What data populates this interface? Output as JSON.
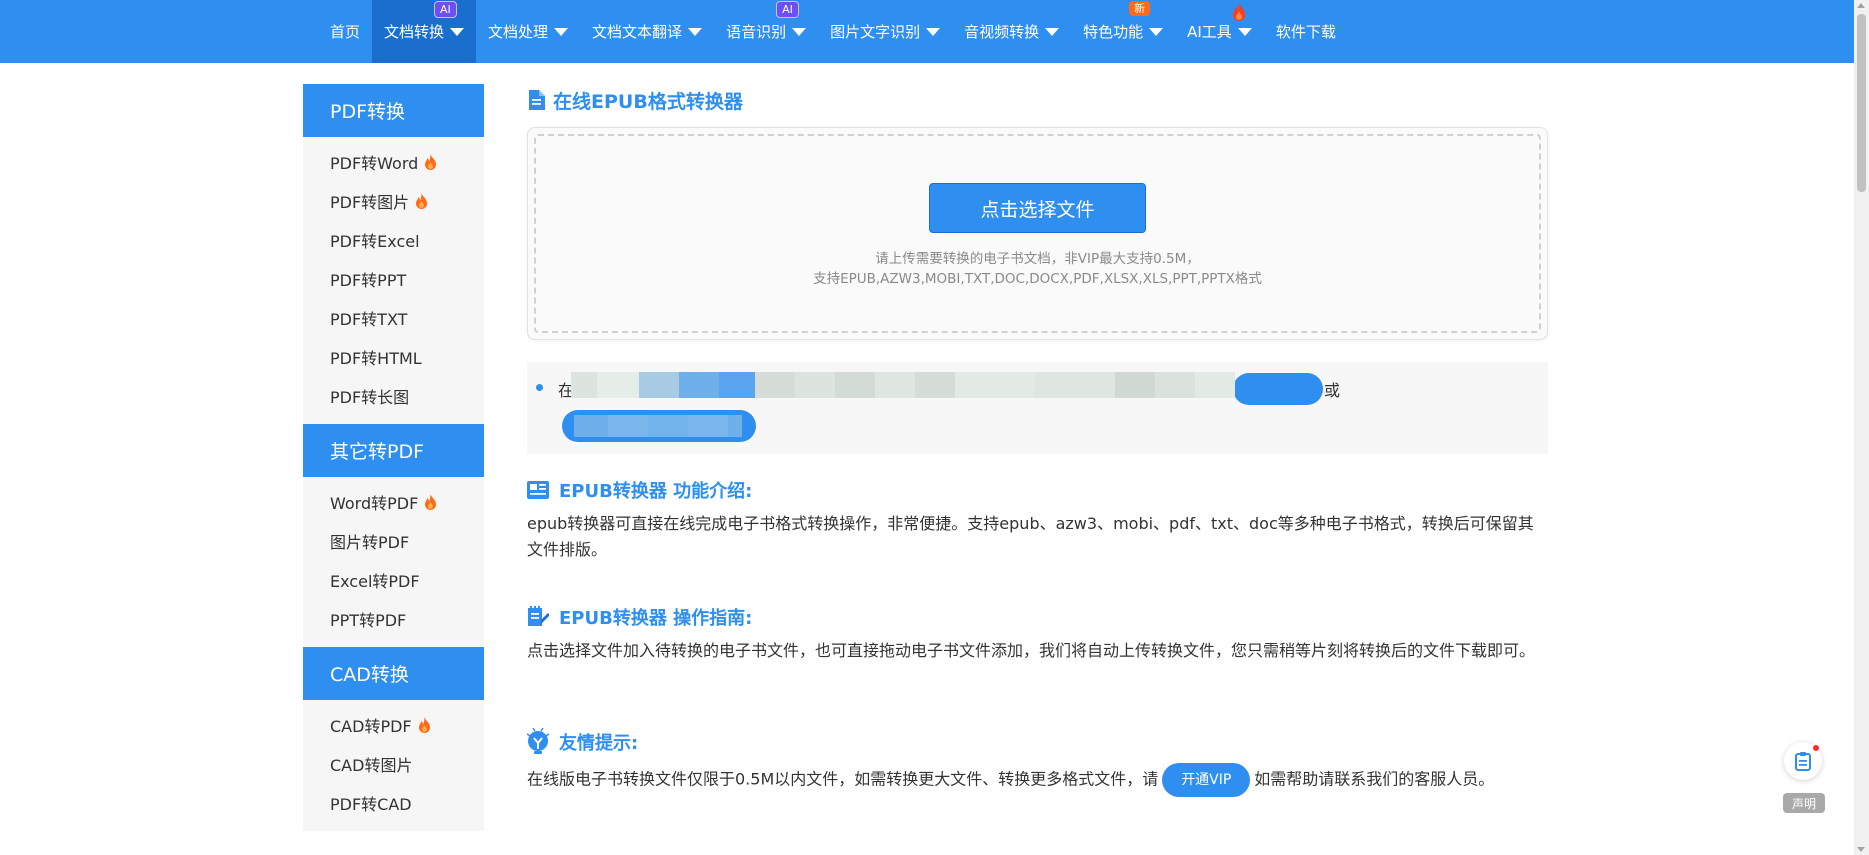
{
  "nav": {
    "items": [
      {
        "label": "首页",
        "caret": false,
        "badge": ""
      },
      {
        "label": "文档转换",
        "caret": true,
        "badge": "AI"
      },
      {
        "label": "文档处理",
        "caret": true,
        "badge": ""
      },
      {
        "label": "文档文本翻译",
        "caret": true,
        "badge": ""
      },
      {
        "label": "语音识别",
        "caret": true,
        "badge": "AI"
      },
      {
        "label": "图片文字识别",
        "caret": true,
        "badge": ""
      },
      {
        "label": "音视频转换",
        "caret": true,
        "badge": ""
      },
      {
        "label": "特色功能",
        "caret": true,
        "badge": "新"
      },
      {
        "label": "AI工具",
        "caret": true,
        "badge": "flame"
      },
      {
        "label": "软件下载",
        "caret": false,
        "badge": ""
      }
    ],
    "active_index": 1
  },
  "sidebar": {
    "groups": [
      {
        "title": "PDF转换",
        "items": [
          {
            "label": "PDF转Word",
            "hot": true
          },
          {
            "label": "PDF转图片",
            "hot": true
          },
          {
            "label": "PDF转Excel",
            "hot": false
          },
          {
            "label": "PDF转PPT",
            "hot": false
          },
          {
            "label": "PDF转TXT",
            "hot": false
          },
          {
            "label": "PDF转HTML",
            "hot": false
          },
          {
            "label": "PDF转长图",
            "hot": false
          }
        ]
      },
      {
        "title": "其它转PDF",
        "items": [
          {
            "label": "Word转PDF",
            "hot": true
          },
          {
            "label": "图片转PDF",
            "hot": false
          },
          {
            "label": "Excel转PDF",
            "hot": false
          },
          {
            "label": "PPT转PDF",
            "hot": false
          }
        ]
      },
      {
        "title": "CAD转换",
        "items": [
          {
            "label": "CAD转PDF",
            "hot": true
          },
          {
            "label": "CAD转图片",
            "hot": false
          },
          {
            "label": "PDF转CAD",
            "hot": false
          }
        ]
      }
    ]
  },
  "main": {
    "title": "在线EPUB格式转换器",
    "upload": {
      "button": "点击选择文件",
      "hint_line1": "请上传需要转换的电子书文档，非VIP最大支持0.5M，",
      "hint_line2": "支持EPUB,AZW3,MOBI,TXT,DOC,DOCX,PDF,XLSX,XLS,PPT,PPTX格式"
    },
    "notice": {
      "prefix": "在",
      "or": "或"
    },
    "sections": {
      "intro": {
        "title": "EPUB转换器 功能介绍:",
        "body": "epub转换器可直接在线完成电子书格式转换操作，非常便捷。支持epub、azw3、mobi、pdf、txt、doc等多种电子书格式，转换后可保留其文件排版。"
      },
      "guide": {
        "title": "EPUB转换器 操作指南:",
        "body": "点击选择文件加入待转换的电子书文件，也可直接拖动电子书文件添加，我们将自动上传转换文件，您只需稍等片刻将转换后的文件下载即可。"
      },
      "tips": {
        "title": "友情提示:",
        "body_before": "在线版电子书转换文件仅限于0.5M以内文件，如需转换更大文件、转换更多格式文件，请",
        "vip_button": "开通VIP",
        "body_after": "如需帮助请联系我们的客服人员。"
      }
    }
  },
  "float": {
    "label": "声明"
  },
  "colors": {
    "primary": "#2f8ff0",
    "primary_dark": "#1a6fce",
    "badge_ai": "#6c4ff5",
    "badge_new": "#ff6a1a"
  }
}
